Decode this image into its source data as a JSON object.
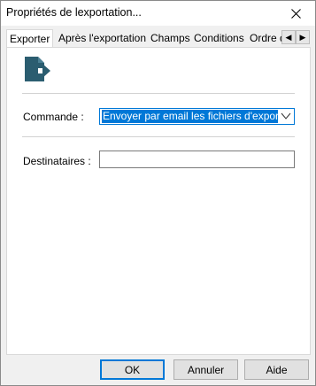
{
  "window": {
    "title": "Propriétés de lexportation..."
  },
  "tabs": [
    {
      "label": "Exporter"
    },
    {
      "label": "Après l'exportation"
    },
    {
      "label": "Champs"
    },
    {
      "label": "Conditions"
    },
    {
      "label": "Ordre d"
    }
  ],
  "tab_scroll": {
    "left": "◀",
    "right": "▶"
  },
  "form": {
    "command_label": "Commande :",
    "command_value": "Envoyer par email les fichiers d'exportation",
    "recipients_label": "Destinataires :",
    "recipients_value": ""
  },
  "buttons": {
    "ok": "OK",
    "cancel": "Annuler",
    "help": "Aide"
  },
  "colors": {
    "accent": "#0078d7",
    "icon": "#2b5d70"
  }
}
